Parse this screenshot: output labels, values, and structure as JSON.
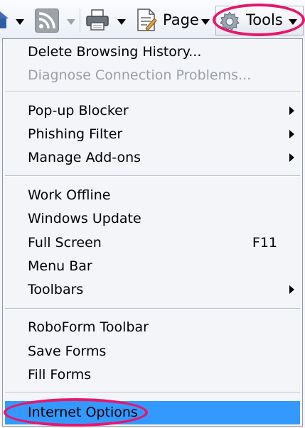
{
  "toolbar": {
    "page_label": "Page",
    "tools_label": "Tools",
    "icons": [
      "home-icon",
      "feeds-icon",
      "print-icon",
      "page-icon",
      "gear-icon"
    ]
  },
  "menu": {
    "groups": [
      [
        {
          "label": "Delete Browsing History...",
          "enabled": true
        },
        {
          "label": "Diagnose Connection Problems...",
          "enabled": false
        }
      ],
      [
        {
          "label": "Pop-up Blocker",
          "submenu": true
        },
        {
          "label": "Phishing Filter",
          "submenu": true
        },
        {
          "label": "Manage Add-ons",
          "submenu": true
        }
      ],
      [
        {
          "label": "Work Offline"
        },
        {
          "label": "Windows Update"
        },
        {
          "label": "Full Screen",
          "shortcut": "F11"
        },
        {
          "label": "Menu Bar"
        },
        {
          "label": "Toolbars",
          "submenu": true
        }
      ],
      [
        {
          "label": "RoboForm Toolbar"
        },
        {
          "label": "Save Forms"
        },
        {
          "label": "Fill Forms"
        }
      ],
      [
        {
          "label": "Internet Options",
          "selected": true
        }
      ]
    ]
  },
  "colors": {
    "selection": "#3399ff",
    "annotation_ring": "#e8166b",
    "disabled_text": "#9b9fa5",
    "menu_background": "#f3f5f9"
  }
}
